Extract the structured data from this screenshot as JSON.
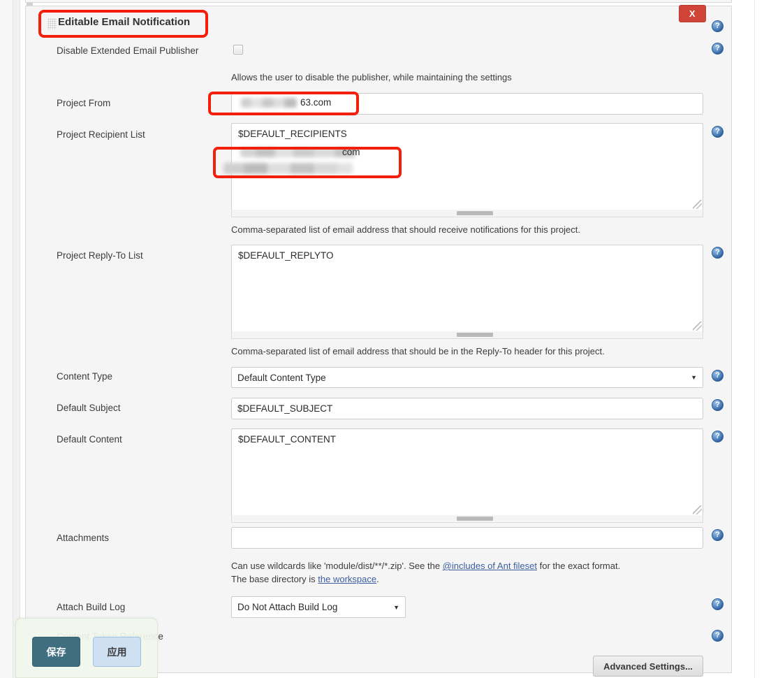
{
  "window": {
    "close_label": "X"
  },
  "section": {
    "title": "Editable Email Notification",
    "drag_handle": "drag-handle-dots"
  },
  "rows": {
    "disable_publisher": {
      "label": "Disable Extended Email Publisher",
      "checked": false,
      "help_text": "Allows the user to disable the publisher, while maintaining the settings"
    },
    "project_from": {
      "label": "Project From",
      "value_visible_suffix": "63.com",
      "value_redacted": true
    },
    "project_recipient_list": {
      "label": "Project Recipient List",
      "value_line1": "$DEFAULT_RECIPIENTS",
      "value_line2_visible_suffix": "com",
      "value_redacted": true,
      "help_text": "Comma-separated list of email address that should receive notifications for this project."
    },
    "project_reply_to_list": {
      "label": "Project Reply-To List",
      "value": "$DEFAULT_REPLYTO",
      "help_text": "Comma-separated list of email address that should be in the Reply-To header for this project."
    },
    "content_type": {
      "label": "Content Type",
      "selected": "Default Content Type"
    },
    "default_subject": {
      "label": "Default Subject",
      "value": "$DEFAULT_SUBJECT"
    },
    "default_content": {
      "label": "Default Content",
      "value": "$DEFAULT_CONTENT"
    },
    "attachments": {
      "label": "Attachments",
      "value": "",
      "placeholder": "",
      "help_text_part1": "Can use wildcards like 'module/dist/**/*.zip'. See the ",
      "help_link1": "@includes of Ant fileset",
      "help_text_part2": " for the exact format.",
      "help_text_part3": "The base directory is ",
      "help_link2": "the workspace",
      "help_text_part4": "."
    },
    "attach_build_log": {
      "label": "Attach Build Log",
      "selected": "Do Not Attach Build Log"
    },
    "content_token_reference": {
      "label": "Content Token Reference"
    }
  },
  "buttons": {
    "advanced_settings": "Advanced Settings...",
    "save": "保存",
    "apply": "应用"
  },
  "icons": {
    "help": "question-mark-help-icon",
    "caret": "▼"
  },
  "colors": {
    "annotation_red": "#f41f0a",
    "close_button_red": "#cf4436",
    "save_button_teal": "#3f6e80",
    "apply_button_blue": "#cfe0f2",
    "help_icon_blue": "#2d5d9c",
    "link_blue": "#3b5f9e",
    "panel_bg": "#f5f5f5"
  }
}
